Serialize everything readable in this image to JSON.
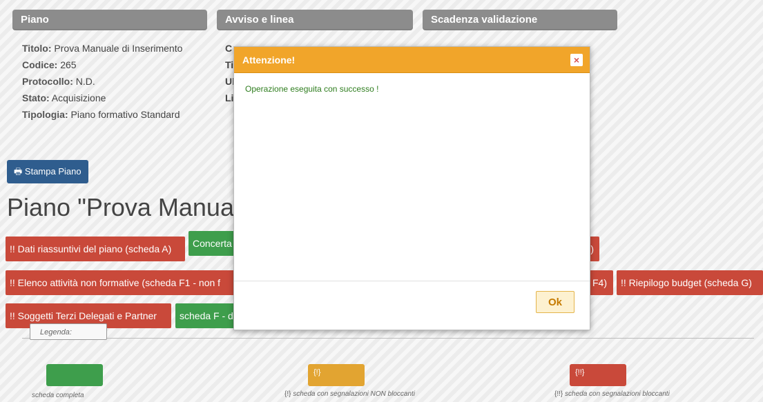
{
  "headers": {
    "piano": "Piano",
    "avviso": "Avviso e linea",
    "scadenza": "Scadenza validazione"
  },
  "info": {
    "titolo_label": "Titolo:",
    "titolo_value": "Prova Manuale di Inserimento",
    "codice_label": "Codice:",
    "codice_value": "265",
    "protocollo_label": "Protocollo:",
    "protocollo_value": "N.D.",
    "stato_label": "Stato:",
    "stato_value": "Acquisizione",
    "tipologia_label": "Tipologia:",
    "tipologia_value": "Piano formativo Standard",
    "col2_frag1": "C",
    "col2_frag2": "Ti",
    "col2_frag3": "Ul",
    "col2_frag4": "Li"
  },
  "print_button": "Stampa Piano",
  "page_title": "Piano \"Prova Manua",
  "tags_row1": {
    "a": "!! Dati riassuntivi del piano (scheda A)",
    "b": "Concerta",
    "c": "B)"
  },
  "tags_row2": {
    "a": "!! Elenco attività non formative (scheda F1 - non f",
    "b": "F4)",
    "c": "!! Riepilogo budget (scheda G)"
  },
  "tags_row3": {
    "a": "!! Soggetti Terzi Delegati e Partner",
    "b": "scheda F - d"
  },
  "legend": {
    "title": "Legenda:",
    "complete_label": "scheda completa",
    "nonblocking_swatch": "{!}",
    "nonblocking_prefix": "{!}",
    "nonblocking_label": "scheda con segnalazioni NON bloccanti",
    "blocking_swatch": "{!!}",
    "blocking_prefix": "{!!}",
    "blocking_label": "scheda con segnalazioni bloccanti"
  },
  "modal": {
    "title": "Attenzione!",
    "close_symbol": "×",
    "message": "Operazione eseguita con successo !",
    "ok_label": "Ok"
  },
  "colors": {
    "header_gray": "#8c8c8c",
    "print_blue": "#2f5d8e",
    "status_red": "#c9493a",
    "status_green": "#3e9e4c",
    "status_orange": "#e2a431",
    "modal_header": "#f1a52a",
    "success_text": "#2e7d1e"
  }
}
